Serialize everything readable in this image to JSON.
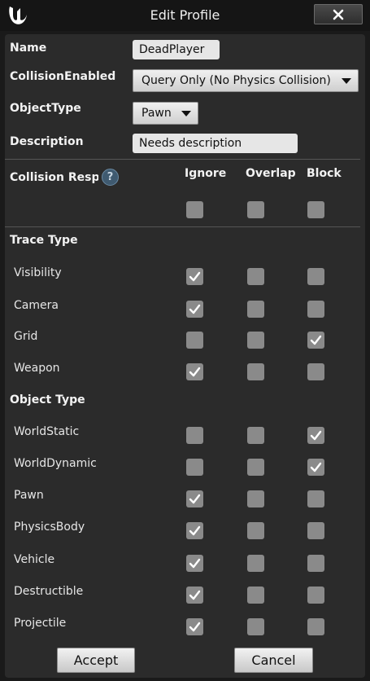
{
  "window": {
    "title": "Edit Profile"
  },
  "fields": {
    "name_label": "Name",
    "name_value": "DeadPlayer",
    "collision_enabled_label": "CollisionEnabled",
    "collision_enabled_value": "Query Only (No Physics Collision)",
    "object_type_label": "ObjectType",
    "object_type_value": "Pawn",
    "description_label": "Description",
    "description_value": "Needs description"
  },
  "responses": {
    "header_label": "Collision Resp",
    "columns": [
      "Ignore",
      "Overlap",
      "Block"
    ],
    "all": {
      "ignore": false,
      "overlap": false,
      "block": false
    }
  },
  "trace_type": {
    "heading": "Trace Type",
    "rows": [
      {
        "label": "Visibility",
        "ignore": true,
        "overlap": false,
        "block": false
      },
      {
        "label": "Camera",
        "ignore": true,
        "overlap": false,
        "block": false
      },
      {
        "label": "Grid",
        "ignore": false,
        "overlap": false,
        "block": true
      },
      {
        "label": "Weapon",
        "ignore": true,
        "overlap": false,
        "block": false
      }
    ]
  },
  "object_type": {
    "heading": "Object Type",
    "rows": [
      {
        "label": "WorldStatic",
        "ignore": false,
        "overlap": false,
        "block": true
      },
      {
        "label": "WorldDynamic",
        "ignore": false,
        "overlap": false,
        "block": true
      },
      {
        "label": "Pawn",
        "ignore": true,
        "overlap": false,
        "block": false
      },
      {
        "label": "PhysicsBody",
        "ignore": true,
        "overlap": false,
        "block": false
      },
      {
        "label": "Vehicle",
        "ignore": true,
        "overlap": false,
        "block": false
      },
      {
        "label": "Destructible",
        "ignore": true,
        "overlap": false,
        "block": false
      },
      {
        "label": "Projectile",
        "ignore": true,
        "overlap": false,
        "block": false
      }
    ]
  },
  "buttons": {
    "accept": "Accept",
    "cancel": "Cancel"
  },
  "icons": {
    "logo": "unreal-logo-icon",
    "close": "close-icon",
    "help": "help-icon",
    "check": "checkmark-icon"
  },
  "colors": {
    "background": "#1a1a1a",
    "panel": "#2b2b2b",
    "checkbox": "#8a8a8a"
  }
}
